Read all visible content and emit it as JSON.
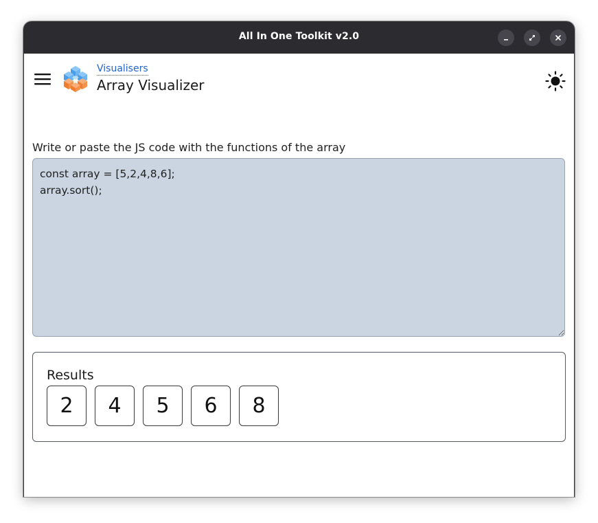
{
  "window": {
    "title": "All In One Toolkit v2.0",
    "controls": {
      "minimize_icon": "minimize-icon",
      "maximize_icon": "maximize-icon",
      "close_icon": "close-icon"
    }
  },
  "header": {
    "menu_icon": "hamburger-menu-icon",
    "logo_icon": "cube-cluster-logo",
    "breadcrumb": "Visualisers",
    "title": "Array Visualizer",
    "theme_icon": "sun-icon"
  },
  "editor": {
    "label": "Write or paste the JS code with the functions of the array",
    "code": "const array = [5,2,4,8,6];\narray.sort();"
  },
  "results": {
    "title": "Results",
    "items": [
      "2",
      "4",
      "5",
      "6",
      "8"
    ]
  },
  "colors": {
    "titlebar": "#2b2b30",
    "editor_bg": "#cbd5e1",
    "link": "#2563c9",
    "logo_blue": "#5aa9f0",
    "logo_orange": "#f4924a"
  }
}
